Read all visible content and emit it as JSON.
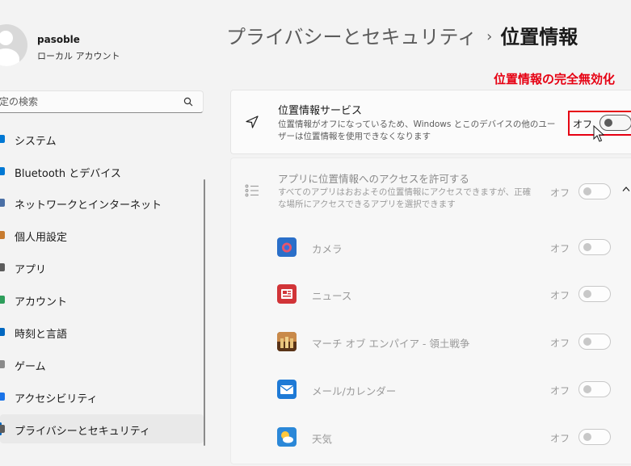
{
  "user": {
    "name": "pasoble",
    "account_type": "ローカル アカウント"
  },
  "search": {
    "placeholder": "定の検索"
  },
  "sidebar": {
    "items": [
      {
        "label": "システム",
        "icon": "system-icon",
        "color": "#0078d4"
      },
      {
        "label": "Bluetooth とデバイス",
        "icon": "bluetooth-icon",
        "color": "#0078d4"
      },
      {
        "label": "ネットワークとインターネット",
        "icon": "network-icon",
        "color": "#4a6fa5"
      },
      {
        "label": "個人用設定",
        "icon": "brush-icon",
        "color": "#c77b2f"
      },
      {
        "label": "アプリ",
        "icon": "apps-icon",
        "color": "#5c5c5c"
      },
      {
        "label": "アカウント",
        "icon": "account-icon",
        "color": "#2e9e5b"
      },
      {
        "label": "時刻と言語",
        "icon": "clock-icon",
        "color": "#0067c0"
      },
      {
        "label": "ゲーム",
        "icon": "game-icon",
        "color": "#8a8a8a"
      },
      {
        "label": "アクセシビリティ",
        "icon": "accessibility-icon",
        "color": "#1a73e8"
      },
      {
        "label": "プライバシーとセキュリティ",
        "icon": "shield-icon",
        "color": "#5c5c5c",
        "active": true
      }
    ]
  },
  "breadcrumb": {
    "parent": "プライバシーとセキュリティ",
    "separator": "›",
    "current": "位置情報"
  },
  "annotation": "位置情報の完全無効化",
  "location_service": {
    "title": "位置情報サービス",
    "description": "位置情報がオフになっているため、Windows とこのデバイスの他のユーザーは位置情報を使用できなくなります",
    "state": "オフ"
  },
  "app_access": {
    "title": "アプリに位置情報へのアクセスを許可する",
    "description": "すべてのアプリはおおよその位置情報にアクセスできますが、正確な場所にアクセスできるアプリを選択できます",
    "state": "オフ"
  },
  "apps": [
    {
      "name": "カメラ",
      "state": "オフ",
      "icon": "camera-icon"
    },
    {
      "name": "ニュース",
      "state": "オフ",
      "icon": "news-icon"
    },
    {
      "name": "マーチ オブ エンパイア - 領土戦争",
      "state": "オフ",
      "icon": "game-app-icon"
    },
    {
      "name": "メール/カレンダー",
      "state": "オフ",
      "icon": "mail-icon"
    },
    {
      "name": "天気",
      "state": "オフ",
      "icon": "weather-icon"
    }
  ],
  "colors": {
    "accent": "#0067c0",
    "annotation": "#e60012"
  }
}
